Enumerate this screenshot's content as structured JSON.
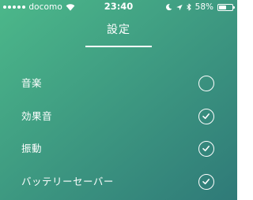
{
  "colors": {
    "gradient_start": "#4cb88a",
    "gradient_end": "#2f7a78",
    "foreground": "#ffffff"
  },
  "status_bar": {
    "carrier": "docomo",
    "signal_bars": 5,
    "signal_filled": 5,
    "time": "23:40",
    "battery_percent": "58%",
    "battery_level": 0.58,
    "icons": [
      "signal-icon",
      "wifi-icon",
      "moon-icon",
      "location-arrow-icon",
      "bluetooth-icon",
      "battery-icon"
    ]
  },
  "header": {
    "title": "設定"
  },
  "settings": {
    "items": [
      {
        "label": "音楽",
        "checked": false
      },
      {
        "label": "効果音",
        "checked": true
      },
      {
        "label": "振動",
        "checked": true
      },
      {
        "label": "バッテリーセーバー",
        "checked": true
      }
    ]
  }
}
